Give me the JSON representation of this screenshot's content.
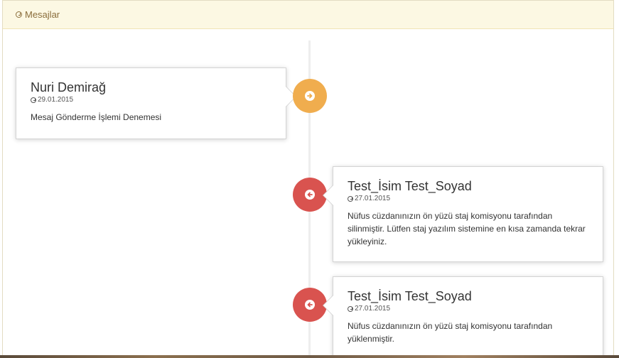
{
  "panel": {
    "title": "Mesajlar",
    "title_icon": "clock-icon"
  },
  "messages": [
    {
      "side": "left",
      "sender": "Nuri Demirağ",
      "date": "29.01.2015",
      "text": "Mesaj Gönderme İşlemi Denemesi",
      "badge_icon": "arrow-right-circle-icon",
      "badge_color": "#f0ad4e"
    },
    {
      "side": "right",
      "sender": "Test_İsim Test_Soyad",
      "date": "27.01.2015",
      "text": "Nüfus cüzdanınızın ön yüzü staj komisyonu tarafından silinmiştir. Lütfen staj yazılım sistemine en kısa zamanda tekrar yükleyiniz.",
      "badge_icon": "arrow-left-circle-icon",
      "badge_color": "#d9534f"
    },
    {
      "side": "right",
      "sender": "Test_İsim Test_Soyad",
      "date": "27.01.2015",
      "text": "Nüfus cüzdanınızın ön yüzü staj komisyonu tarafından yüklenmiştir.",
      "badge_icon": "arrow-left-circle-icon",
      "badge_color": "#d9534f"
    }
  ]
}
